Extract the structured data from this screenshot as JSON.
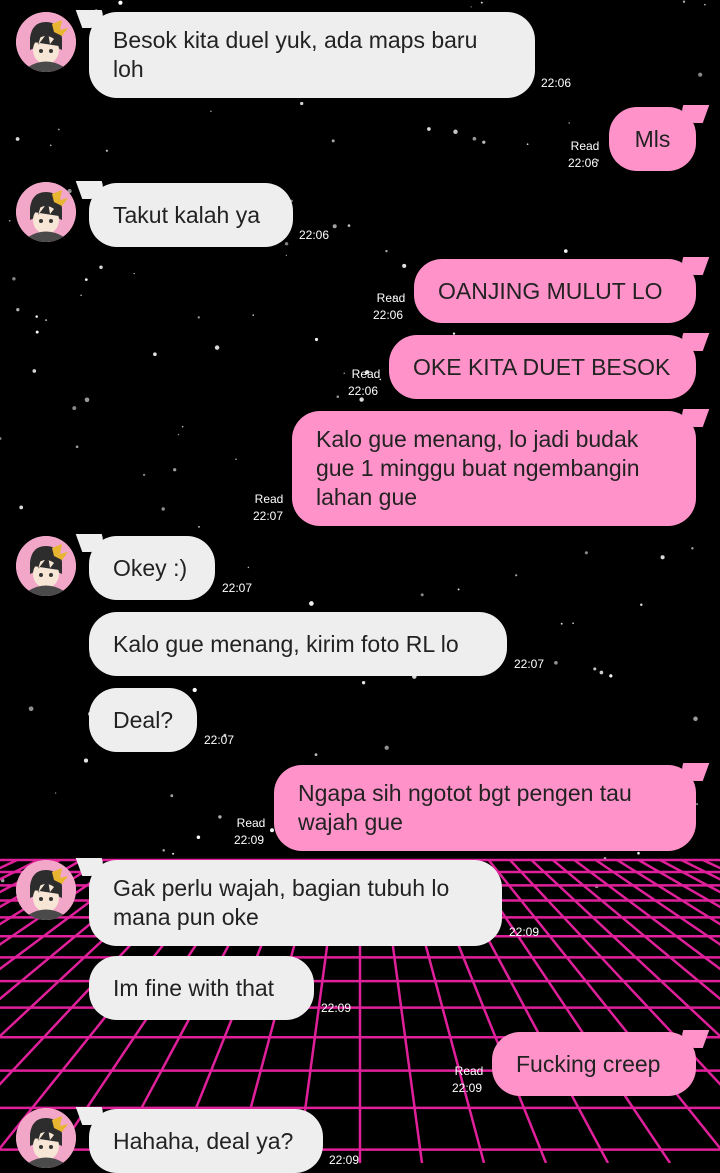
{
  "colors": {
    "incoming_bubble": "#eeeeee",
    "outgoing_bubble": "#ff93c9",
    "grid_line": "#e0209a",
    "background": "#000000"
  },
  "messages": [
    {
      "dir": "in",
      "avatar": true,
      "text": "Besok kita duel yuk, ada maps baru loh",
      "time": "22:06"
    },
    {
      "dir": "out",
      "text": "Mls",
      "status": "Read",
      "time": "22:06"
    },
    {
      "dir": "in",
      "avatar": true,
      "text": "Takut kalah ya",
      "time": "22:06"
    },
    {
      "dir": "out",
      "text": "OANJING MULUT LO",
      "status": "Read",
      "time": "22:06"
    },
    {
      "dir": "out",
      "text": "OKE KITA DUET BESOK",
      "status": "Read",
      "time": "22:06"
    },
    {
      "dir": "out",
      "text": "Kalo gue menang, lo jadi budak gue 1 minggu buat ngembangin lahan gue",
      "status": "Read",
      "time": "22:07"
    },
    {
      "dir": "in",
      "avatar": true,
      "text": "Okey :)",
      "time": "22:07"
    },
    {
      "dir": "in",
      "text": "Kalo gue menang, kirim foto RL lo",
      "time": "22:07"
    },
    {
      "dir": "in",
      "text": "Deal?",
      "time": "22:07"
    },
    {
      "dir": "out",
      "text": "Ngapa sih ngotot bgt pengen tau wajah gue",
      "status": "Read",
      "time": "22:09"
    },
    {
      "dir": "in",
      "avatar": true,
      "text": "Gak perlu wajah, bagian tubuh lo mana pun oke",
      "time": "22:09"
    },
    {
      "dir": "in",
      "text": "Im fine with that",
      "time": "22:09"
    },
    {
      "dir": "out",
      "text": "Fucking creep",
      "status": "Read",
      "time": "22:09"
    },
    {
      "dir": "in",
      "avatar": true,
      "text": "Hahaha, deal ya?",
      "time": "22:09"
    }
  ]
}
